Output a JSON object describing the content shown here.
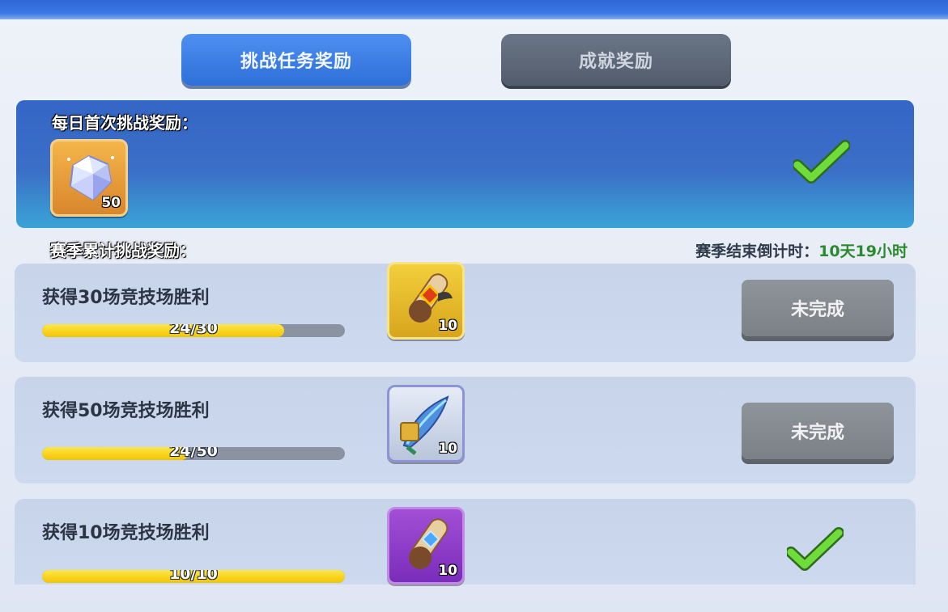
{
  "tabs": {
    "active_label": "挑战任务奖励",
    "inactive_label": "成就奖励"
  },
  "daily_reward": {
    "title": "每日首次挑战奖励：",
    "item": {
      "icon": "diamond-icon",
      "qty": "50"
    },
    "status_icon": "check-icon"
  },
  "season": {
    "title": "赛季累计挑战奖励：",
    "countdown_label": "赛季结束倒计时：",
    "countdown_value": "10天19小时"
  },
  "tasks": [
    {
      "title": "获得30场竞技场胜利",
      "progress_text": "24/30",
      "progress_fraction": 0.8,
      "reward": {
        "icon": "gold-scroll-icon",
        "qty": "10"
      },
      "status_label": "未完成"
    },
    {
      "title": "获得50场竞技场胜利",
      "progress_text": "24/50",
      "progress_fraction": 0.48,
      "reward": {
        "icon": "feather-icon",
        "qty": "10"
      },
      "status_label": "未完成"
    },
    {
      "title": "获得10场竞技场胜利",
      "progress_text": "10/10",
      "progress_fraction": 1.0,
      "reward": {
        "icon": "purple-scroll-icon",
        "qty": "10"
      },
      "status_icon": "check-icon"
    }
  ],
  "colors": {
    "accent_blue": "#2e6fd9",
    "progress_yellow": "#f2c400",
    "countdown_green": "#2b8a2f"
  }
}
